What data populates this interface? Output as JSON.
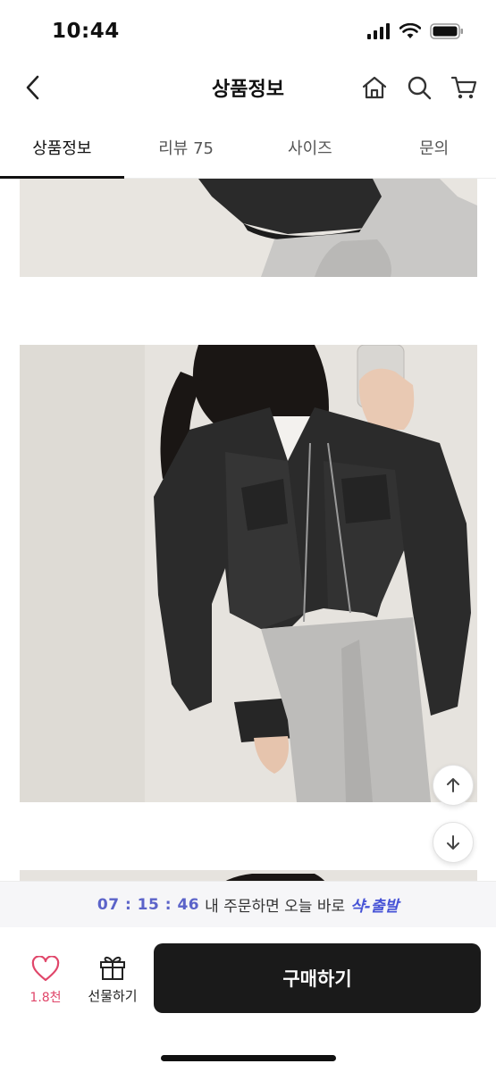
{
  "status_bar": {
    "time": "10:44"
  },
  "header": {
    "title": "상품정보"
  },
  "tabs": [
    {
      "label": "상품정보",
      "active": true
    },
    {
      "label": "리뷰 75",
      "active": false
    },
    {
      "label": "사이즈",
      "active": false
    },
    {
      "label": "문의",
      "active": false
    }
  ],
  "promo": {
    "timer": "07 : 15 : 46",
    "message": "내 주문하면 오늘 바로",
    "brand": "샥-출발"
  },
  "bottom": {
    "like_count": "1.8천",
    "gift_label": "선물하기",
    "buy_label": "구매하기"
  },
  "colors": {
    "accent": "#4552d6",
    "timer": "#5b63c9",
    "like": "#e0466a",
    "buy_button": "#1a1a1a"
  },
  "icons": [
    "back-icon",
    "home-icon",
    "search-icon",
    "cart-icon",
    "arrow-up-icon",
    "arrow-down-icon",
    "heart-icon",
    "gift-icon"
  ]
}
